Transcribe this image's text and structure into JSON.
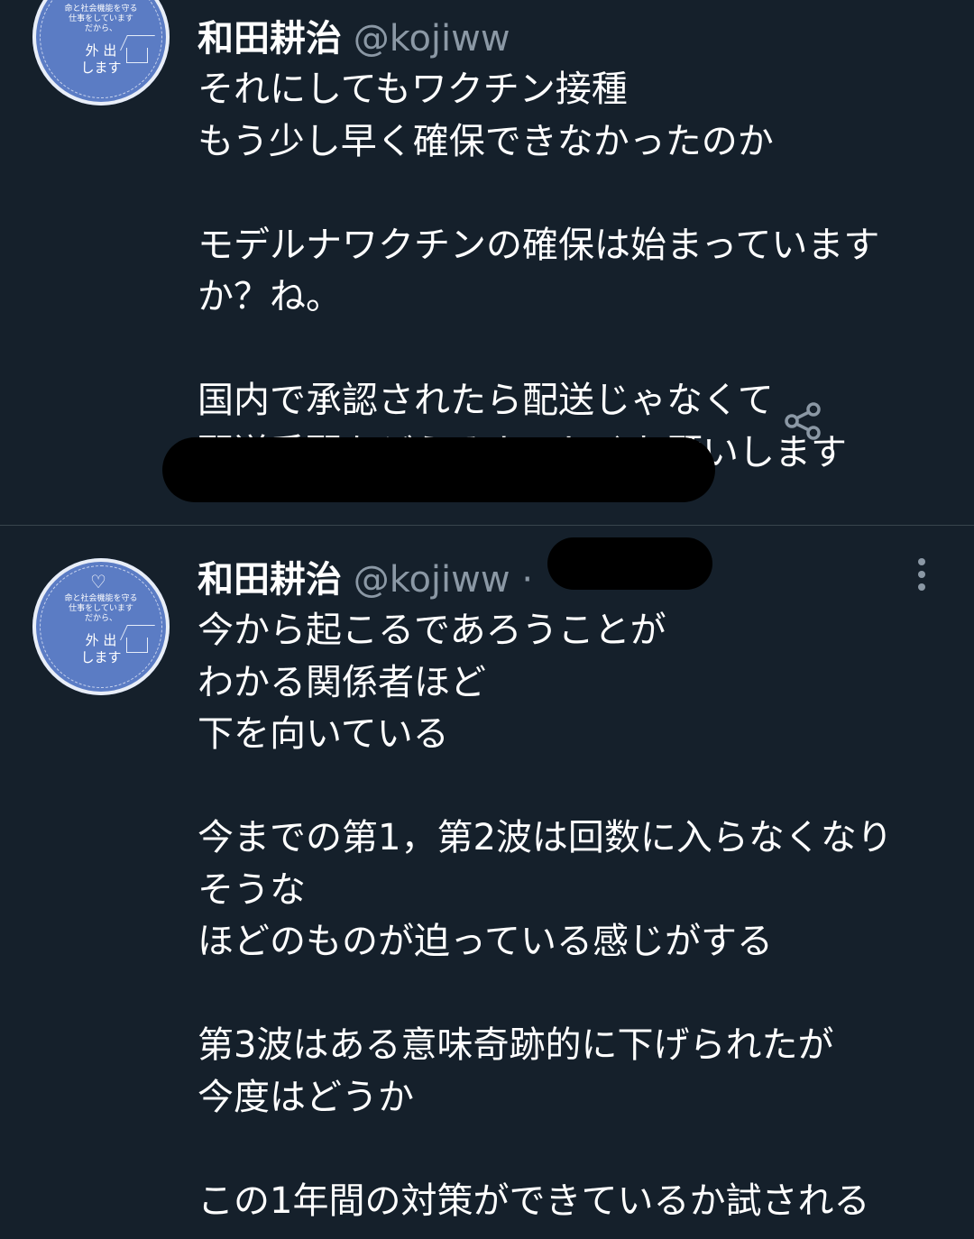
{
  "tweets": [
    {
      "display_name": "和田耕治",
      "handle": "@kojiww",
      "body": "それにしてもワクチン接種\nもう少し早く確保できなかったのか\n\nモデルナワクチンの確保は始まっています\nか？ね。\n\n国内で承認されたら配送じゃなくて\n配送手配をどうぞよろしくお願いします",
      "avatar": {
        "tagline": "命と社会機能を守る\n仕事をしています\nだから、",
        "main": "外 出\nします"
      }
    },
    {
      "display_name": "和田耕治",
      "handle": "@kojiww",
      "separator": "·",
      "body": "今から起こるであろうことが\nわかる関係者ほど\n下を向いている\n\n今までの第1，第2波は回数に入らなくなり\nそうな\nほどのものが迫っている感じがする\n\n第3波はある意味奇跡的に下げられたが\n今度はどうか\n\nこの1年間の対策ができているか試される",
      "avatar": {
        "tagline": "命と社会機能を守る\n仕事をしています\nだから、",
        "main": "外 出\nします"
      }
    }
  ],
  "icons": {
    "share": "share-icon",
    "more": "more-options-icon",
    "heart": "heart-icon"
  },
  "colors": {
    "background": "#15202b",
    "divider": "#38444d",
    "text_primary": "#ffffff",
    "text_secondary": "#8b98a5",
    "avatar_bg": "#5b7cc4"
  }
}
